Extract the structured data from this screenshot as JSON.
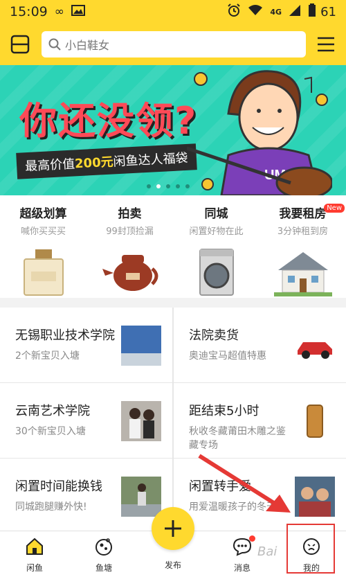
{
  "status_bar": {
    "time": "15:09",
    "battery": "61",
    "network": "4G"
  },
  "header": {
    "search_placeholder": "小白鞋女"
  },
  "banner": {
    "headline": "你还没领?",
    "tag_prefix": "最高价值",
    "tag_amount": "200元",
    "tag_suffix": "闲鱼达人福袋",
    "shirt_text": "UM"
  },
  "quick_entries": [
    {
      "title": "超级划算",
      "subtitle": "喊你买买买",
      "icon": "perfume-image"
    },
    {
      "title": "拍卖",
      "subtitle": "99封顶捡漏",
      "icon": "teapot-image"
    },
    {
      "title": "同城",
      "subtitle": "闲置好物在此",
      "icon": "washing-machine-image"
    },
    {
      "title": "我要租房",
      "subtitle": "3分钟租到房",
      "icon": "house-image",
      "badge": "New"
    }
  ],
  "ponds": [
    {
      "title": "无锡职业技术学院",
      "subtitle": "2个新宝贝入塘",
      "thumb": "blue-fabric-thumb"
    },
    {
      "title": "法院卖货",
      "subtitle": "奥迪宝马超值特惠",
      "thumb": "red-car-thumb"
    },
    {
      "title": "云南艺术学院",
      "subtitle": "30个新宝贝入塘",
      "thumb": "girls-photo-thumb"
    },
    {
      "title": "距结束5小时",
      "subtitle": "秋收冬藏莆田木雕之鉴藏专场",
      "thumb": "wood-carving-thumb"
    },
    {
      "title": "闲置时间能换钱",
      "subtitle": "同城跑腿赚外快!",
      "thumb": "runner-thumb"
    },
    {
      "title": "闲置转手爱",
      "subtitle": "用爱温暖孩子的冬天",
      "thumb": "children-thumb"
    }
  ],
  "bottom_nav": [
    {
      "label": "闲鱼",
      "icon": "home-icon"
    },
    {
      "label": "鱼塘",
      "icon": "pond-icon"
    },
    {
      "label": "发布",
      "icon": "plus-icon"
    },
    {
      "label": "消息",
      "icon": "message-icon"
    },
    {
      "label": "我的",
      "icon": "profile-icon"
    }
  ],
  "watermark": "Bai",
  "colors": {
    "brand_yellow": "#ffd92e",
    "banner_teal": "#2cd3b6",
    "headline_red": "#ff4a57",
    "annotation_red": "#e53935"
  }
}
